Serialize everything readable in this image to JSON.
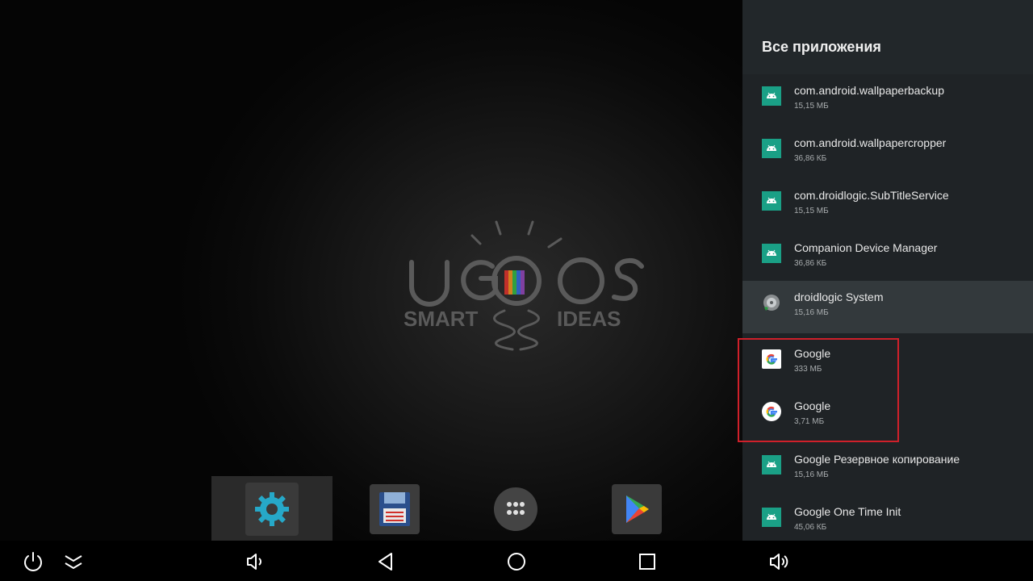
{
  "wallpaper": {
    "logo_text": "UGOOS",
    "logo_tagline_left": "SMART",
    "logo_tagline_right": "IDEAS"
  },
  "panel": {
    "title": "Все приложения",
    "apps": [
      {
        "name": "com.android.wallpaperbackup",
        "size": "15,15 МБ",
        "icon": "android-icon"
      },
      {
        "name": "com.android.wallpapercropper",
        "size": "36,86 КБ",
        "icon": "android-icon"
      },
      {
        "name": "com.droidlogic.SubTitleService",
        "size": "15,15 МБ",
        "icon": "android-icon"
      },
      {
        "name": "Companion Device Manager",
        "size": "36,86 КБ",
        "icon": "android-icon"
      },
      {
        "name": "droidlogic System",
        "size": "15,16 МБ",
        "icon": "droidlogic-icon"
      },
      {
        "name": "Google",
        "size": "333 МБ",
        "icon": "google-icon"
      },
      {
        "name": "Google",
        "size": "3,71 МБ",
        "icon": "google-icon"
      },
      {
        "name": "Google Резервное копирование",
        "size": "15,16 МБ",
        "icon": "android-icon"
      },
      {
        "name": "Google One Time Init",
        "size": "45,06 КБ",
        "icon": "android-icon"
      }
    ]
  },
  "dock": {
    "items": [
      "settings-icon",
      "file-manager-icon",
      "all-apps-icon",
      "play-store-icon"
    ]
  },
  "navbar": {
    "buttons": [
      "power-icon",
      "collapse-icon",
      "volume-down-icon",
      "back-icon",
      "home-icon",
      "recents-icon",
      "volume-up-icon"
    ]
  },
  "colors": {
    "panel_bg": "#1f2326",
    "highlight": "#d0202a",
    "android_green": "#1aa086"
  }
}
